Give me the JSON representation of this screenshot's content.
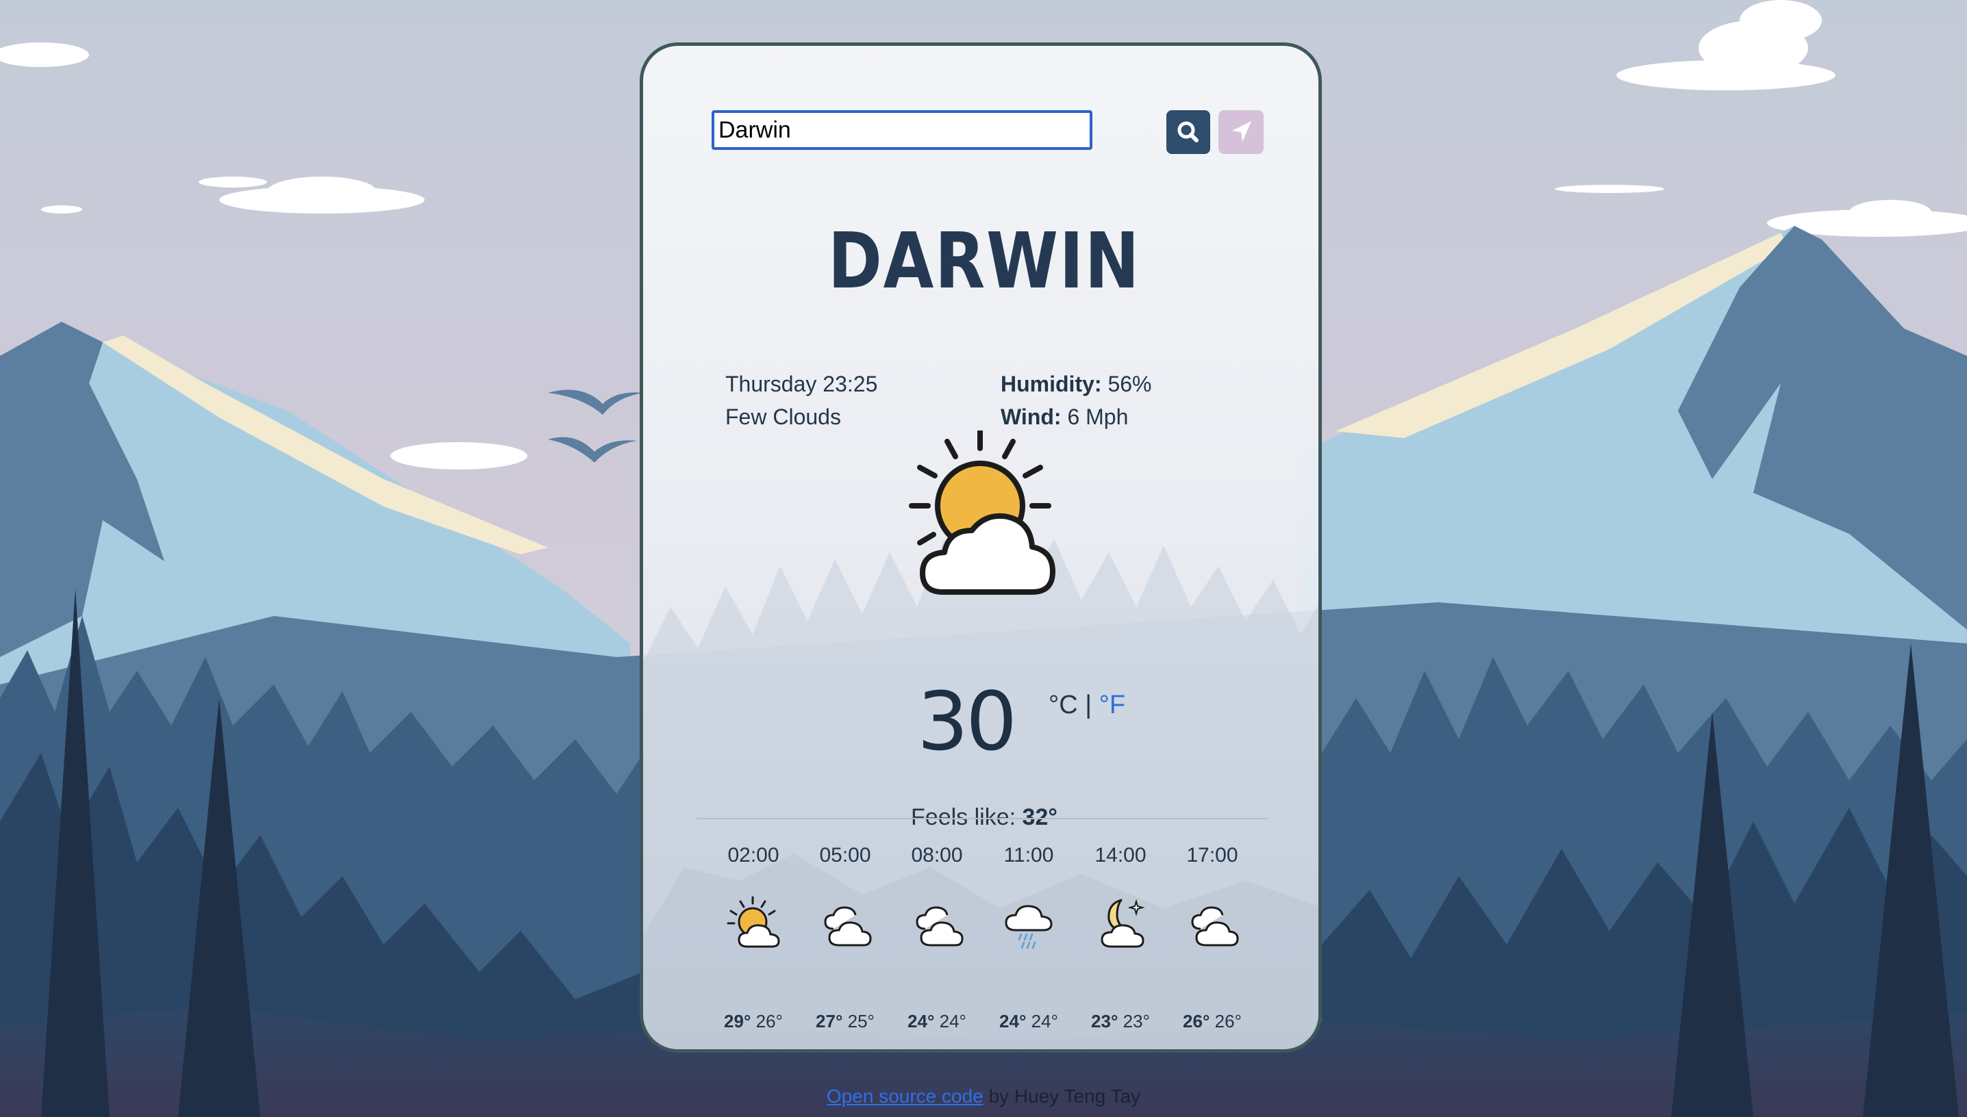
{
  "search": {
    "value": "Darwin"
  },
  "icons": {
    "search_button": "search-icon",
    "locate_button": "location-arrow-icon",
    "main_condition": "sun-behind-cloud-icon"
  },
  "city": "DARWIN",
  "details": {
    "datetime": "Thursday 23:25",
    "condition": "Few Clouds",
    "humidity_label": "Humidity:",
    "humidity_value": "56%",
    "wind_label": "Wind:",
    "wind_value": "6 Mph"
  },
  "temperature": {
    "value": "30",
    "unit_c": "°C",
    "separator": "|",
    "unit_f": "°F"
  },
  "feels_like": {
    "label": "Feels like:",
    "value": "32°"
  },
  "forecast": [
    {
      "time": "02:00",
      "icon": "sun-cloud-icon",
      "high": "29°",
      "low": "26°"
    },
    {
      "time": "05:00",
      "icon": "clouds-icon",
      "high": "27°",
      "low": "25°"
    },
    {
      "time": "08:00",
      "icon": "clouds-icon",
      "high": "24°",
      "low": "24°"
    },
    {
      "time": "11:00",
      "icon": "rain-cloud-icon",
      "high": "24°",
      "low": "24°"
    },
    {
      "time": "14:00",
      "icon": "moon-cloud-icon",
      "high": "23°",
      "low": "23°"
    },
    {
      "time": "17:00",
      "icon": "clouds-icon",
      "high": "26°",
      "low": "26°"
    }
  ],
  "footer": {
    "link_text": "Open source code",
    "suffix": "by Huey Teng Tay"
  },
  "colors": {
    "accent": "#2f4d6c",
    "locate_button": "#d5c2da",
    "fahrenheit_link": "#2f6fda",
    "sun": "#f0b843",
    "title": "#253a52"
  }
}
